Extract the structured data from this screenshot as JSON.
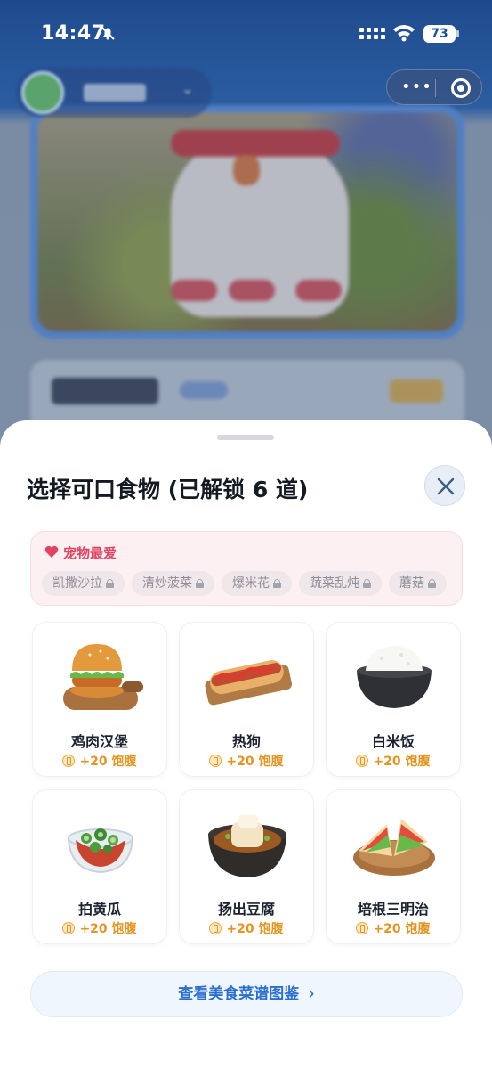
{
  "status_bar": {
    "time": "14:47",
    "battery": "73"
  },
  "sheet": {
    "title": "选择可口食物 (已解锁 6 道)",
    "favorites": {
      "title": "宠物最爱",
      "items": [
        {
          "label": "凯撒沙拉",
          "locked": true
        },
        {
          "label": "清炒菠菜",
          "locked": true
        },
        {
          "label": "爆米花",
          "locked": true
        },
        {
          "label": "蔬菜乱炖",
          "locked": true
        },
        {
          "label": "蘑菇",
          "locked": true
        }
      ]
    },
    "foods": [
      {
        "name": "鸡肉汉堡",
        "bonus": "+20 饱腹",
        "icon": "chicken-burger-icon"
      },
      {
        "name": "热狗",
        "bonus": "+20 饱腹",
        "icon": "hot-dog-icon"
      },
      {
        "name": "白米饭",
        "bonus": "+20 饱腹",
        "icon": "white-rice-icon"
      },
      {
        "name": "拍黄瓜",
        "bonus": "+20 饱腹",
        "icon": "cucumber-salad-icon"
      },
      {
        "name": "扬出豆腐",
        "bonus": "+20 饱腹",
        "icon": "fried-tofu-icon"
      },
      {
        "name": "培根三明治",
        "bonus": "+20 饱腹",
        "icon": "bacon-sandwich-icon"
      }
    ],
    "recipe_button": "查看美食菜谱图鉴"
  },
  "colors": {
    "accent": "#2a6fcf",
    "favorite": "#e0445f",
    "bonus": "#e49420"
  }
}
